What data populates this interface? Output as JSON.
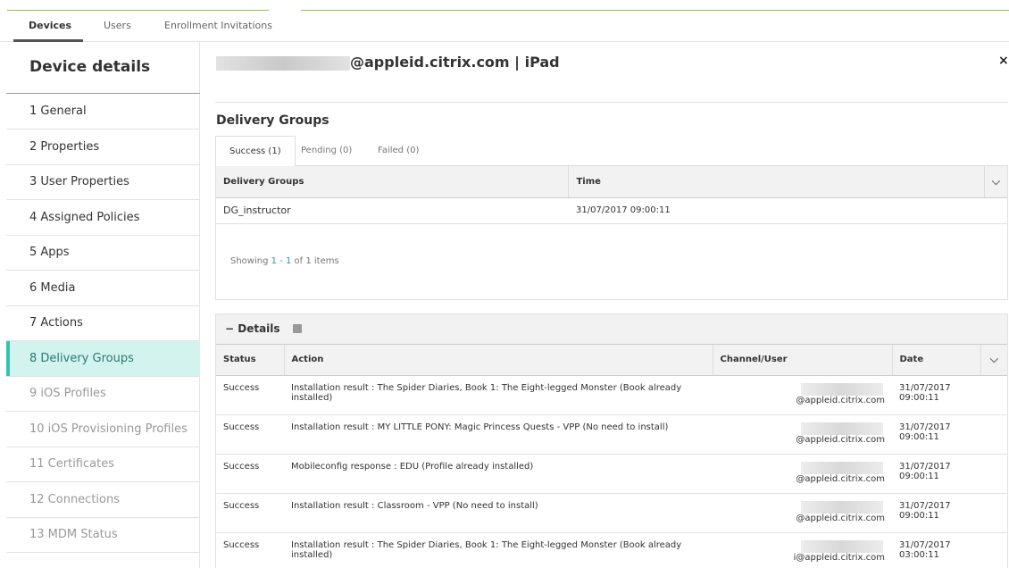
{
  "top_tabs": [
    "Devices",
    "Users",
    "Enrollment Invitations"
  ],
  "sidebar": {
    "title": "Device details",
    "items": [
      {
        "label": "1 General",
        "state": "normal"
      },
      {
        "label": "2 Properties",
        "state": "normal"
      },
      {
        "label": "3 User Properties",
        "state": "normal"
      },
      {
        "label": "4 Assigned Policies",
        "state": "normal"
      },
      {
        "label": "5 Apps",
        "state": "normal"
      },
      {
        "label": "6 Media",
        "state": "normal"
      },
      {
        "label": "7 Actions",
        "state": "normal"
      },
      {
        "label": "8 Delivery Groups",
        "state": "active"
      },
      {
        "label": "9 iOS Profiles",
        "state": "disabled"
      },
      {
        "label": "10 iOS Provisioning Profiles",
        "state": "disabled"
      },
      {
        "label": "11 Certificates",
        "state": "disabled"
      },
      {
        "label": "12 Connections",
        "state": "disabled"
      },
      {
        "label": "13 MDM Status",
        "state": "disabled"
      }
    ]
  },
  "header": {
    "title": "@appleid.citrix.com | iPad",
    "close": "×"
  },
  "delivery_groups": {
    "title": "Delivery Groups",
    "tabs": [
      "Success (1)",
      "Pending (0)",
      "Failed (0)"
    ],
    "columns": [
      "Delivery Groups",
      "Time"
    ],
    "rows": [
      [
        "DG_instructor",
        "31/07/2017 09:00:11"
      ]
    ],
    "showing": {
      "prefix": "Showing ",
      "range": "1 - 1",
      "suffix": " of 1 items"
    }
  },
  "details": {
    "label": "− Details",
    "columns": [
      "Status",
      "Action",
      "Channel/User",
      "Date"
    ],
    "rows": [
      [
        "Success",
        "Installation result : The Spider Diaries, Book 1: The Eight-legged Monster (Book already installed)",
        "@appleid.citrix.com",
        "31/07/2017 09:00:11"
      ],
      [
        "Success",
        "Installation result : MY LITTLE PONY: Magic Princess Quests - VPP (No need to install)",
        "@appleid.citrix.com",
        "31/07/2017 09:00:11"
      ],
      [
        "Success",
        "Mobileconfig response : EDU (Profile already installed)",
        "@appleid.citrix.com",
        "31/07/2017 09:00:11"
      ],
      [
        "Success",
        "Installation result : Classroom - VPP (No need to install)",
        "@appleid.citrix.com",
        "31/07/2017 09:00:11"
      ],
      [
        "Success",
        "Installation result : The Spider Diaries, Book 1: The Eight-legged Monster (Book already installed)",
        "i@appleid.citrix.com",
        "31/07/2017 03:00:11"
      ]
    ]
  },
  "icons": {
    "chevron": "chevron-down-icon",
    "details_toggle": "details-settings-icon"
  }
}
